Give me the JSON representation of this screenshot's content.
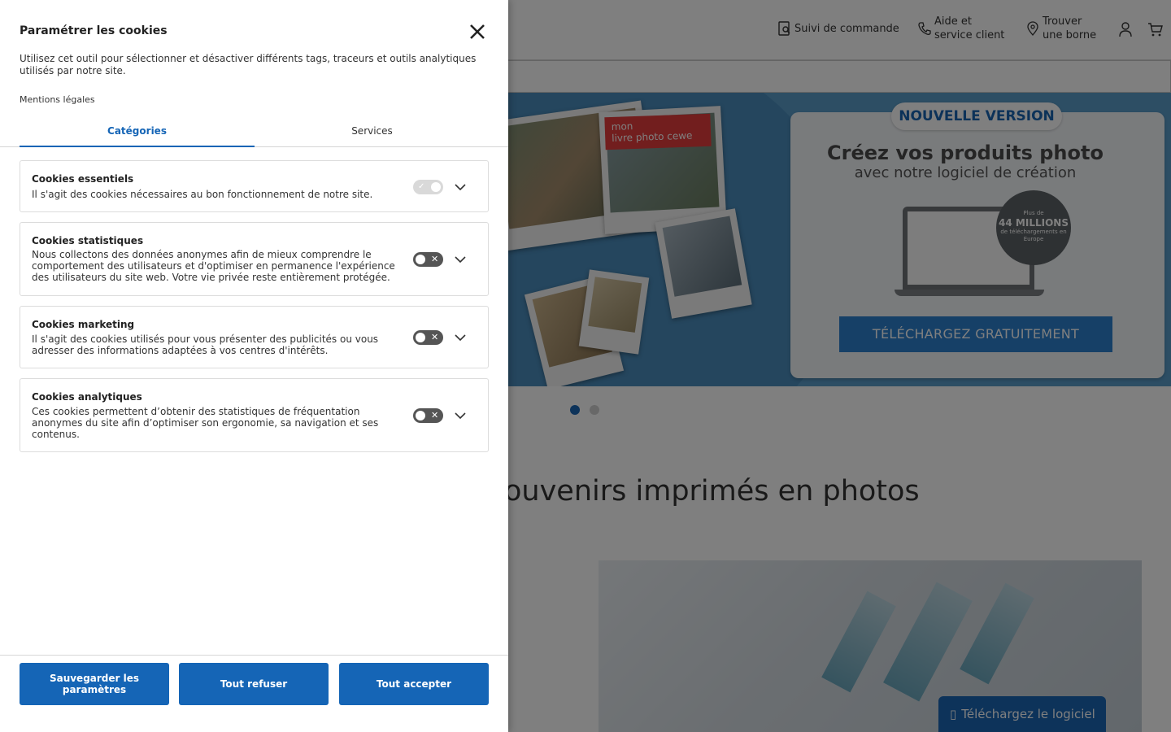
{
  "background": {
    "header": {
      "order_tracking": "Suivi de commande",
      "help_line1": "Aide et",
      "help_line2": "service client",
      "store_line1": "Trouver",
      "store_line2": "une borne"
    },
    "hero": {
      "book_tag_line1": "mon",
      "book_tag_line2": "livre photo cewe",
      "badge": "NOUVELLE VERSION",
      "title": "Créez vos produits photo",
      "subtitle": "avec notre logiciel de création",
      "downloads_prefix": "Plus de",
      "downloads_count": "44 MILLIONS",
      "downloads_suffix": "de téléchargements en Europe",
      "cta": "TÉLÉCHARGEZ GRATUITEMENT",
      "active_slide": 1,
      "slide_count": 2
    },
    "section_title": "ouvenirs imprimés en photos",
    "download_button": "Téléchargez le logiciel"
  },
  "cookie_panel": {
    "title": "Paramétrer les cookies",
    "description": "Utilisez cet outil pour sélectionner et désactiver différents tags, traceurs et outils analytiques utilisés par notre site.",
    "legal_link": "Mentions légales",
    "tabs": [
      {
        "label": "Catégories",
        "active": true
      },
      {
        "label": "Services",
        "active": false
      }
    ],
    "categories": [
      {
        "name": "Cookies essentiels",
        "description": "Il s'agit des cookies nécessaires au bon fonctionnement de notre site.",
        "enabled": true,
        "locked": true
      },
      {
        "name": "Cookies statistiques",
        "description": "Nous collectons des données anonymes afin de mieux comprendre le comportement des utilisateurs et d'optimiser en permanence l'expérience des utilisateurs du site web. Votre vie privée reste entièrement protégée.",
        "enabled": false,
        "locked": false
      },
      {
        "name": "Cookies marketing",
        "description": "Il s'agit des cookies utilisés pour vous présenter des publicités ou vous adresser des informations adaptées à vos centres d'intérêts.",
        "enabled": false,
        "locked": false
      },
      {
        "name": "Cookies analytiques",
        "description": "Ces cookies permettent d’obtenir des statistiques de fréquentation anonymes du site afin d’optimiser son ergonomie, sa navigation et ses contenus.",
        "enabled": false,
        "locked": false
      }
    ],
    "buttons": {
      "save": "Sauvegarder les paramètres",
      "refuse": "Tout refuser",
      "accept": "Tout accepter"
    }
  },
  "colors": {
    "primary": "#1565b6",
    "overlay": "rgba(0,0,0,0.5)",
    "toggle_off": "#555555",
    "toggle_disabled": "#d9d9d9"
  },
  "icons": {
    "close": "close-icon",
    "chevron": "chevron-down-icon",
    "order": "order-search-icon",
    "phone": "phone-icon",
    "pin": "location-pin-icon",
    "account": "user-icon",
    "cart": "cart-icon",
    "laptop": "laptop-icon"
  }
}
